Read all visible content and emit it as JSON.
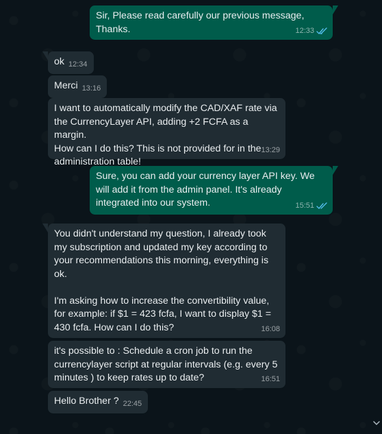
{
  "conversation": {
    "messages": [
      {
        "id": "m1",
        "dir": "out",
        "text": "Sir, Please read carefully our previous message,\nThanks.",
        "time": "12:33",
        "status": "read"
      },
      {
        "id": "m2",
        "dir": "in",
        "text": "ok",
        "time": "12:34"
      },
      {
        "id": "m3",
        "dir": "in",
        "text": "Merci",
        "time": "13:16"
      },
      {
        "id": "m4",
        "dir": "in",
        "text": "I want to automatically modify the CAD/XAF rate via\nthe CurrencyLayer API, adding +2 FCFA as a margin.\nHow can I do this? This is not provided for in the\nadministration table!",
        "time": "13:29"
      },
      {
        "id": "m5",
        "dir": "out",
        "text": "Sure, you can add your currency layer API key. We\nwill add it from the admin panel. It's already\nintegrated into our system.",
        "time": "15:51",
        "status": "read"
      },
      {
        "id": "m6",
        "dir": "in",
        "text": "You didn't understand my question, I already took\nmy subscription and updated my key according to\nyour recommendations this morning, everything is\nok.\n\nI'm asking how to increase the convertibility value,\nfor example: if $1 = 423 fcfa, I want to display $1 =\n430 fcfa. How can I do this?",
        "time": "16:08"
      },
      {
        "id": "m7",
        "dir": "in",
        "text": "it's possible to : Schedule a cron job to run the\ncurrencylayer script at regular intervals (e.g. every 5\nminutes ) to keep rates up to date?",
        "time": "16:51"
      },
      {
        "id": "m8",
        "dir": "in",
        "text": "Hello Brother ?",
        "time": "22:45"
      }
    ]
  },
  "colors": {
    "background": "#0b141a",
    "incoming_bubble": "#202c33",
    "outgoing_bubble": "#005c4b",
    "read_tick": "#53bdeb",
    "text": "#e9edef"
  },
  "icons": {
    "read_status": "double-check-icon",
    "scroll": "chevron-down-icon"
  }
}
